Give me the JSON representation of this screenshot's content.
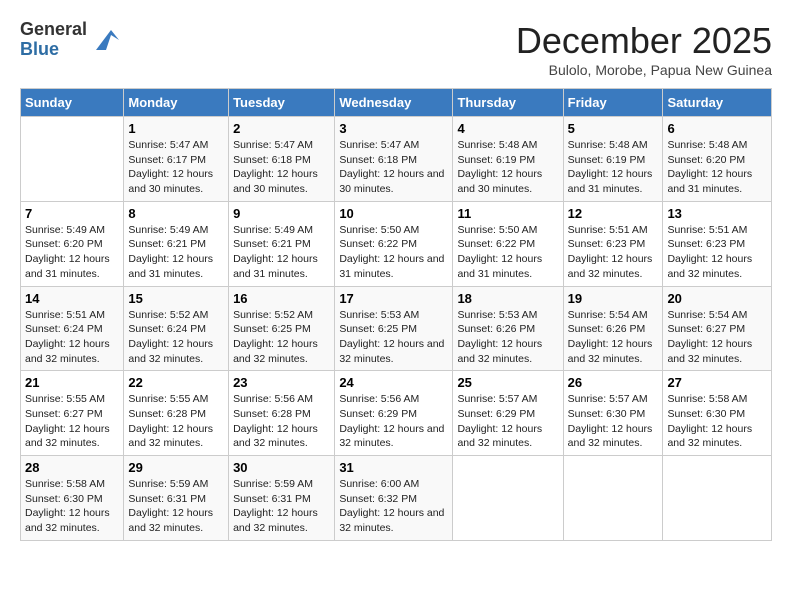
{
  "logo": {
    "general": "General",
    "blue": "Blue"
  },
  "title": "December 2025",
  "subtitle": "Bulolo, Morobe, Papua New Guinea",
  "days_header": [
    "Sunday",
    "Monday",
    "Tuesday",
    "Wednesday",
    "Thursday",
    "Friday",
    "Saturday"
  ],
  "weeks": [
    [
      {
        "day": "",
        "sunrise": "",
        "sunset": "",
        "daylight": ""
      },
      {
        "day": "1",
        "sunrise": "Sunrise: 5:47 AM",
        "sunset": "Sunset: 6:17 PM",
        "daylight": "Daylight: 12 hours and 30 minutes."
      },
      {
        "day": "2",
        "sunrise": "Sunrise: 5:47 AM",
        "sunset": "Sunset: 6:18 PM",
        "daylight": "Daylight: 12 hours and 30 minutes."
      },
      {
        "day": "3",
        "sunrise": "Sunrise: 5:47 AM",
        "sunset": "Sunset: 6:18 PM",
        "daylight": "Daylight: 12 hours and 30 minutes."
      },
      {
        "day": "4",
        "sunrise": "Sunrise: 5:48 AM",
        "sunset": "Sunset: 6:19 PM",
        "daylight": "Daylight: 12 hours and 30 minutes."
      },
      {
        "day": "5",
        "sunrise": "Sunrise: 5:48 AM",
        "sunset": "Sunset: 6:19 PM",
        "daylight": "Daylight: 12 hours and 31 minutes."
      },
      {
        "day": "6",
        "sunrise": "Sunrise: 5:48 AM",
        "sunset": "Sunset: 6:20 PM",
        "daylight": "Daylight: 12 hours and 31 minutes."
      }
    ],
    [
      {
        "day": "7",
        "sunrise": "Sunrise: 5:49 AM",
        "sunset": "Sunset: 6:20 PM",
        "daylight": "Daylight: 12 hours and 31 minutes."
      },
      {
        "day": "8",
        "sunrise": "Sunrise: 5:49 AM",
        "sunset": "Sunset: 6:21 PM",
        "daylight": "Daylight: 12 hours and 31 minutes."
      },
      {
        "day": "9",
        "sunrise": "Sunrise: 5:49 AM",
        "sunset": "Sunset: 6:21 PM",
        "daylight": "Daylight: 12 hours and 31 minutes."
      },
      {
        "day": "10",
        "sunrise": "Sunrise: 5:50 AM",
        "sunset": "Sunset: 6:22 PM",
        "daylight": "Daylight: 12 hours and 31 minutes."
      },
      {
        "day": "11",
        "sunrise": "Sunrise: 5:50 AM",
        "sunset": "Sunset: 6:22 PM",
        "daylight": "Daylight: 12 hours and 31 minutes."
      },
      {
        "day": "12",
        "sunrise": "Sunrise: 5:51 AM",
        "sunset": "Sunset: 6:23 PM",
        "daylight": "Daylight: 12 hours and 32 minutes."
      },
      {
        "day": "13",
        "sunrise": "Sunrise: 5:51 AM",
        "sunset": "Sunset: 6:23 PM",
        "daylight": "Daylight: 12 hours and 32 minutes."
      }
    ],
    [
      {
        "day": "14",
        "sunrise": "Sunrise: 5:51 AM",
        "sunset": "Sunset: 6:24 PM",
        "daylight": "Daylight: 12 hours and 32 minutes."
      },
      {
        "day": "15",
        "sunrise": "Sunrise: 5:52 AM",
        "sunset": "Sunset: 6:24 PM",
        "daylight": "Daylight: 12 hours and 32 minutes."
      },
      {
        "day": "16",
        "sunrise": "Sunrise: 5:52 AM",
        "sunset": "Sunset: 6:25 PM",
        "daylight": "Daylight: 12 hours and 32 minutes."
      },
      {
        "day": "17",
        "sunrise": "Sunrise: 5:53 AM",
        "sunset": "Sunset: 6:25 PM",
        "daylight": "Daylight: 12 hours and 32 minutes."
      },
      {
        "day": "18",
        "sunrise": "Sunrise: 5:53 AM",
        "sunset": "Sunset: 6:26 PM",
        "daylight": "Daylight: 12 hours and 32 minutes."
      },
      {
        "day": "19",
        "sunrise": "Sunrise: 5:54 AM",
        "sunset": "Sunset: 6:26 PM",
        "daylight": "Daylight: 12 hours and 32 minutes."
      },
      {
        "day": "20",
        "sunrise": "Sunrise: 5:54 AM",
        "sunset": "Sunset: 6:27 PM",
        "daylight": "Daylight: 12 hours and 32 minutes."
      }
    ],
    [
      {
        "day": "21",
        "sunrise": "Sunrise: 5:55 AM",
        "sunset": "Sunset: 6:27 PM",
        "daylight": "Daylight: 12 hours and 32 minutes."
      },
      {
        "day": "22",
        "sunrise": "Sunrise: 5:55 AM",
        "sunset": "Sunset: 6:28 PM",
        "daylight": "Daylight: 12 hours and 32 minutes."
      },
      {
        "day": "23",
        "sunrise": "Sunrise: 5:56 AM",
        "sunset": "Sunset: 6:28 PM",
        "daylight": "Daylight: 12 hours and 32 minutes."
      },
      {
        "day": "24",
        "sunrise": "Sunrise: 5:56 AM",
        "sunset": "Sunset: 6:29 PM",
        "daylight": "Daylight: 12 hours and 32 minutes."
      },
      {
        "day": "25",
        "sunrise": "Sunrise: 5:57 AM",
        "sunset": "Sunset: 6:29 PM",
        "daylight": "Daylight: 12 hours and 32 minutes."
      },
      {
        "day": "26",
        "sunrise": "Sunrise: 5:57 AM",
        "sunset": "Sunset: 6:30 PM",
        "daylight": "Daylight: 12 hours and 32 minutes."
      },
      {
        "day": "27",
        "sunrise": "Sunrise: 5:58 AM",
        "sunset": "Sunset: 6:30 PM",
        "daylight": "Daylight: 12 hours and 32 minutes."
      }
    ],
    [
      {
        "day": "28",
        "sunrise": "Sunrise: 5:58 AM",
        "sunset": "Sunset: 6:30 PM",
        "daylight": "Daylight: 12 hours and 32 minutes."
      },
      {
        "day": "29",
        "sunrise": "Sunrise: 5:59 AM",
        "sunset": "Sunset: 6:31 PM",
        "daylight": "Daylight: 12 hours and 32 minutes."
      },
      {
        "day": "30",
        "sunrise": "Sunrise: 5:59 AM",
        "sunset": "Sunset: 6:31 PM",
        "daylight": "Daylight: 12 hours and 32 minutes."
      },
      {
        "day": "31",
        "sunrise": "Sunrise: 6:00 AM",
        "sunset": "Sunset: 6:32 PM",
        "daylight": "Daylight: 12 hours and 32 minutes."
      },
      {
        "day": "",
        "sunrise": "",
        "sunset": "",
        "daylight": ""
      },
      {
        "day": "",
        "sunrise": "",
        "sunset": "",
        "daylight": ""
      },
      {
        "day": "",
        "sunrise": "",
        "sunset": "",
        "daylight": ""
      }
    ]
  ]
}
